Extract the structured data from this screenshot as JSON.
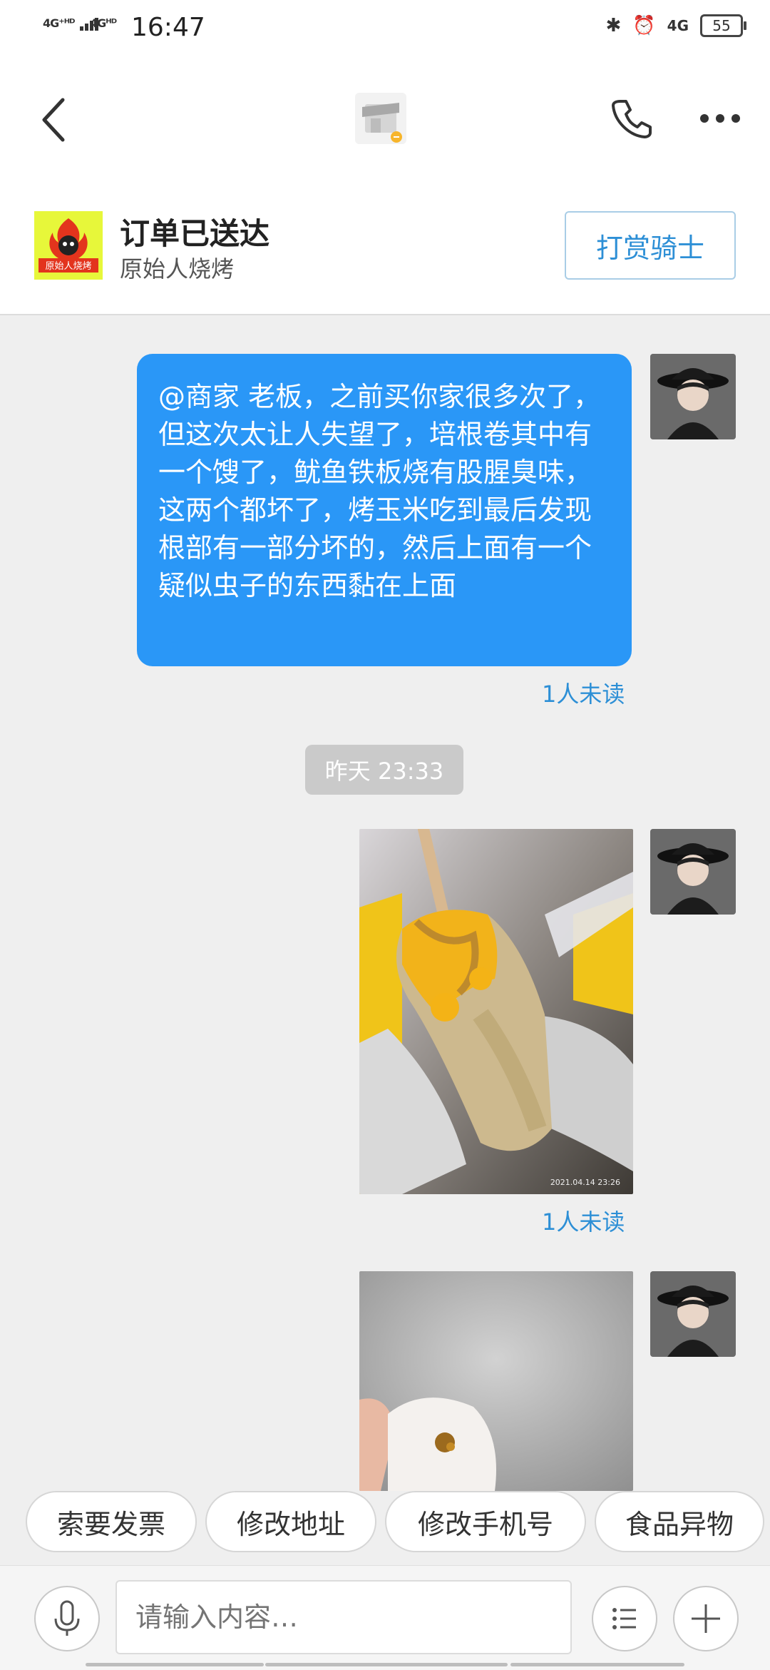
{
  "status_bar": {
    "network_1": "4G⁺ᴴᴰ",
    "network_2": "4Gᴴᴰ",
    "time": "16:47",
    "network_3": "4G",
    "battery": "55"
  },
  "header": {
    "back_icon": "chevron-left-icon",
    "store_icon": "store-icon",
    "phone_icon": "phone-icon",
    "more_icon": "more-icon"
  },
  "order": {
    "status": "订单已送达",
    "shop_name": "原始人烧烤",
    "logo_text": "原始人烧烤",
    "tip_button": "打赏骑士"
  },
  "messages": [
    {
      "type": "text",
      "text": "@商家 老板，之前买你家很多次了，但这次太让人失望了，培根卷其中有一个馊了，鱿鱼铁板烧有股腥臭味，这两个都坏了，烤玉米吃到最后发现根部有一部分坏的，然后上面有一个疑似虫子的东西黏在上面",
      "read_status": "1人未读"
    },
    {
      "type": "time",
      "label": "昨天 23:33"
    },
    {
      "type": "image",
      "subject": "grilled corn photo",
      "stamp": "2021.04.14 23:26",
      "read_status": "1人未读"
    },
    {
      "type": "image",
      "subject": "food foreign object photo"
    }
  ],
  "quick_replies": [
    "索要发票",
    "修改地址",
    "修改手机号",
    "食品异物"
  ],
  "input": {
    "placeholder": "请输入内容…",
    "mic_icon": "microphone-icon",
    "list_icon": "list-icon",
    "plus_icon": "plus-icon"
  },
  "colors": {
    "accent": "#2a97f7",
    "link": "#2d8fd6",
    "background": "#efefef"
  }
}
